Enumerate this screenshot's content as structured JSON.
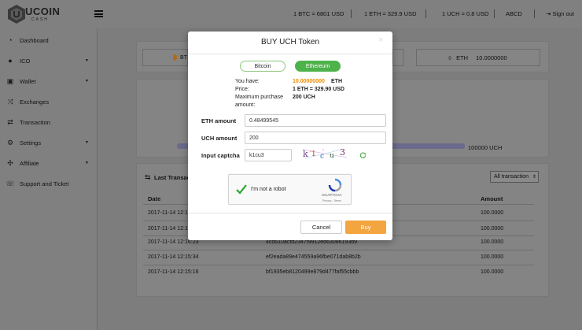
{
  "header": {
    "logo_main": "UCOIN",
    "logo_sub": "CASH",
    "rates": [
      "1 BTC = 6801 USD",
      "1 ETH = 329.9 USD",
      "1 UCH = 0.8 USD"
    ],
    "username": "ABCD",
    "signout_label": "Sign out"
  },
  "sidebar": {
    "items": [
      {
        "label": "Dashboard",
        "icon": "dashboard-icon"
      },
      {
        "label": "ICO",
        "icon": "coin-icon",
        "caret": "▼"
      },
      {
        "label": "Wallet",
        "icon": "wallet-icon",
        "caret": "▼"
      },
      {
        "label": "Exchanges",
        "icon": "exchange-icon"
      },
      {
        "label": "Transaction",
        "icon": "transaction-icon"
      },
      {
        "label": "Settings",
        "icon": "gear-icon",
        "caret": "▼"
      },
      {
        "label": "Affiliate",
        "icon": "affiliate-icon",
        "caret": "▼"
      },
      {
        "label": "Support and Ticket",
        "icon": "support-icon"
      }
    ]
  },
  "balances": {
    "btc_label": "BT",
    "eth_label": "ETH",
    "eth_value": "10.0000000"
  },
  "progress": {
    "label": "100000 UCH",
    "fraction": 1.0
  },
  "transactions": {
    "title": "Last Transact",
    "filter_value": "All transaction",
    "headers": {
      "date": "Date",
      "amount": "Amount"
    },
    "rows": [
      {
        "date": "2017-11-14 12:1",
        "hash": "",
        "amount": "100.0000"
      },
      {
        "date": "2017-11-14 12:1",
        "hash": "",
        "amount": "100.0000"
      },
      {
        "date": "2017-11-14 12:16:23",
        "hash": "4cd610acfd2347f9912ed63086193b9",
        "amount": "100.0000"
      },
      {
        "date": "2017-11-14 12:15:34",
        "hash": "ef2eada89e474559a96fbe071dab8b2b",
        "amount": "100.0000"
      },
      {
        "date": "2017-11-14 12:15:16",
        "hash": "bf1935eb8120499e879d477faf55cbbb",
        "amount": "100.0000"
      }
    ]
  },
  "modal": {
    "title": "BUY UCH Token",
    "close": "×",
    "tab_bitcoin": "Bitcoin",
    "tab_ethereum": "Ethereum",
    "you_have_label": "You have:",
    "you_have_value": "10.00000000",
    "you_have_unit": "ETH",
    "price_label": "Price:",
    "price_value": "1 ETH = 329.90 USD",
    "max_label_1": "Maximum purchase",
    "max_label_2": "amount:",
    "max_value": "200 UCH",
    "eth_amount_label": "ETH amount",
    "eth_amount_value": "0.48499545",
    "uch_amount_label": "UCH amount",
    "uch_amount_value": "200",
    "captcha_label": "Input captcha",
    "captcha_value": "k1cu3",
    "captcha_text": "k1cu3",
    "recaptcha_label": "I'm not a robot",
    "recaptcha_brand": "reCAPTCHA",
    "recaptcha_terms": "Privacy - Terms",
    "cancel_label": "Cancel",
    "buy_label": "Buy"
  },
  "colors": {
    "accent_green": "#4eb24a",
    "accent_orange": "#f3a540",
    "balance_orange": "#f08a00"
  }
}
